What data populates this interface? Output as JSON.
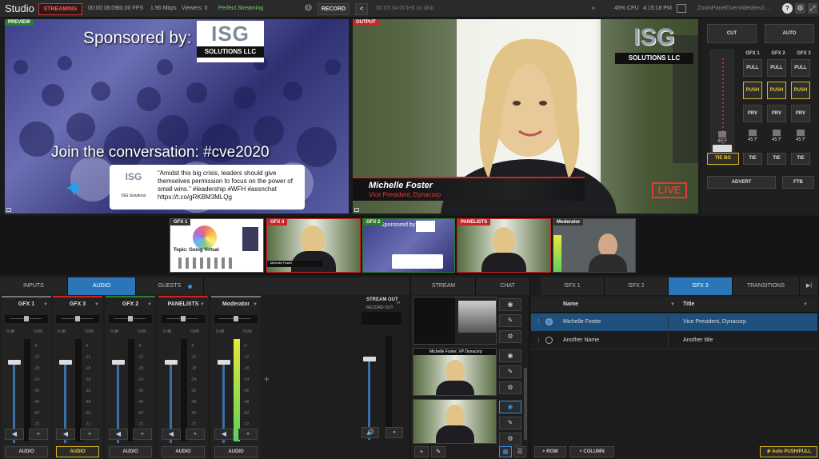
{
  "app": {
    "title": "Studio",
    "stream_label": "STREAMING",
    "time": "00:00:38;09",
    "fps": "30.00 FPS",
    "bitrate": "1.96 Mbps",
    "viewers": "Viewers: 0",
    "status": "Perfect Streaming",
    "record_label": "RECORD",
    "disk": "00:03:34:00 left on disk",
    "cpu": "46% CPU",
    "clock": "4:15:18 PM",
    "doc": "ZoomPanelOverVideo6ev2...."
  },
  "preview": {
    "label": "PREVIEW",
    "sponsored": "Sponsored by:",
    "logo_top": "ISG",
    "logo_bottom": "SOLUTIONS LLC",
    "tagline": "Join the conversation: #cve2020",
    "tweet": "“Amidst this big crisis, leaders should give themselves permission to focus on the power of small wins.” #leadership #WFH #assnchat https://t.co/gRKBM3MLQg",
    "tweet_author": "ISG Solutions",
    "tweet_logo": "ISG"
  },
  "output": {
    "label": "OUTPUT",
    "name": "Michelle Foster",
    "title": "Vice President, Dynacorp",
    "live": "LIVE",
    "logo_top": "ISG",
    "logo_bottom": "SOLUTIONS LLC"
  },
  "switcher": {
    "cut": "CUT",
    "auto": "AUTO",
    "gfx": [
      "GFX 1",
      "GFX 2",
      "GFX 3"
    ],
    "pull": "PULL",
    "push": "PUSH",
    "prv": "PRV",
    "f45": "45 F",
    "tiebg": "TIE BG",
    "tie": "TIE",
    "advert": "ADVERT",
    "ftb": "FTB"
  },
  "sources": [
    {
      "label": "GFX 1",
      "color": "#333333"
    },
    {
      "label": "GFX 3",
      "color": "#cc2222"
    },
    {
      "label": "GFX 2",
      "color": "#2e7d32"
    },
    {
      "label": "PANELISTS",
      "color": "#cc2222"
    },
    {
      "label": "Moderator",
      "color": "#333333"
    }
  ],
  "thumbs": {
    "topic": "Topic: Going Virtual",
    "sponsored": "Sponsored by:",
    "name_line": "Michelle Foster, VP Dynacorp"
  },
  "audio": {
    "tabs": [
      "INPUTS",
      "AUDIO",
      "GUESTS"
    ],
    "channels": [
      {
        "name": "GFX 1",
        "color": "#777777"
      },
      {
        "name": "GFX 3",
        "color": "#cc2222"
      },
      {
        "name": "GFX 2",
        "color": "#2e7d32"
      },
      {
        "name": "PANELISTS",
        "color": "#cc2222"
      },
      {
        "name": "Moderator",
        "color": "#777777"
      }
    ],
    "stream_out": "STREAM OUT",
    "record_out": "RECORD OUT",
    "audio_btn": "AUDIO",
    "ovr": "OVR",
    "db0": "0 dB",
    "scale": [
      "-6",
      "-12",
      "-18",
      "-24",
      "-36",
      "-48",
      "-60",
      "-72"
    ]
  },
  "right": {
    "tabs": [
      "STREAM",
      "CHAT",
      "GFX 1",
      "GFX 2",
      "GFX 3",
      "TRANSITIONS"
    ],
    "col_name": "Name",
    "col_title": "Title",
    "rows": [
      {
        "name": "Michelle Foster",
        "title": "Vice President, Dynacorp"
      },
      {
        "name": "Another Name",
        "title": "Another title"
      }
    ],
    "add_row": "ROW",
    "add_col": "COLUMN",
    "auto_push": "Auto PUSH/PULL"
  }
}
